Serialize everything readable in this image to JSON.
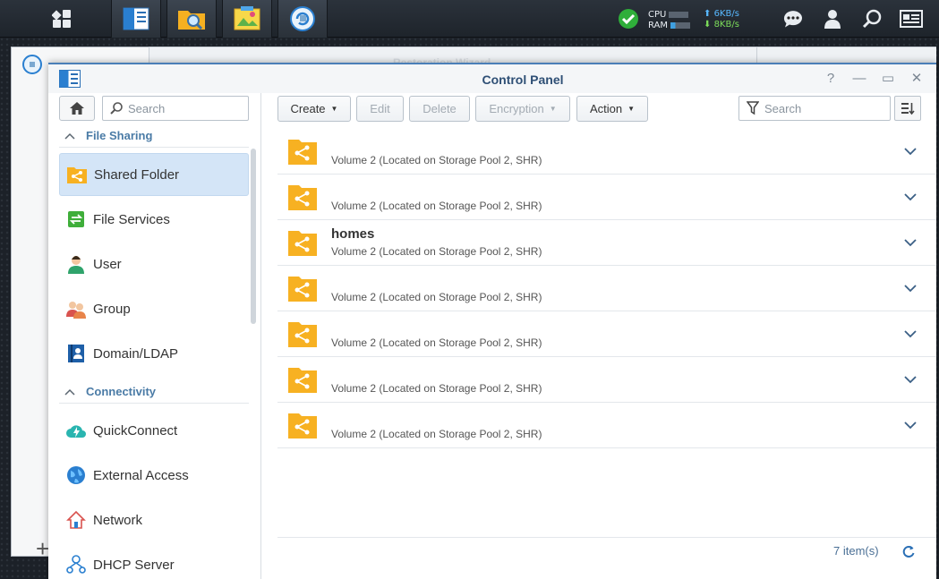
{
  "taskbar": {
    "perf": {
      "cpu_label": "CPU",
      "ram_label": "RAM",
      "upload": "6KB/s",
      "download": "8KB/s"
    }
  },
  "background_window": {
    "title": "Restoration Wizard"
  },
  "window": {
    "title": "Control Panel",
    "help": "?",
    "minimize": "—",
    "maximize": "▭",
    "close": "✕"
  },
  "sidebar": {
    "search_placeholder": "Search",
    "sections": [
      {
        "label": "File Sharing",
        "items": [
          {
            "label": "Shared Folder",
            "icon": "shared-folder-icon"
          },
          {
            "label": "File Services",
            "icon": "file-services-icon"
          },
          {
            "label": "User",
            "icon": "user-icon"
          },
          {
            "label": "Group",
            "icon": "group-icon"
          },
          {
            "label": "Domain/LDAP",
            "icon": "domain-ldap-icon"
          }
        ]
      },
      {
        "label": "Connectivity",
        "items": [
          {
            "label": "QuickConnect",
            "icon": "quickconnect-icon"
          },
          {
            "label": "External Access",
            "icon": "external-access-icon"
          },
          {
            "label": "Network",
            "icon": "network-icon"
          },
          {
            "label": "DHCP Server",
            "icon": "dhcp-server-icon"
          }
        ]
      }
    ]
  },
  "toolbar": {
    "create": "Create",
    "edit": "Edit",
    "delete": "Delete",
    "encryption": "Encryption",
    "action": "Action",
    "search_placeholder": "Search"
  },
  "folders": [
    {
      "name": "",
      "desc": "Volume 2 (Located on Storage Pool 2, SHR)"
    },
    {
      "name": "",
      "desc": "Volume 2 (Located on Storage Pool 2, SHR)"
    },
    {
      "name": "homes",
      "desc": "Volume 2 (Located on Storage Pool 2, SHR)"
    },
    {
      "name": "",
      "desc": "Volume 2 (Located on Storage Pool 2, SHR)"
    },
    {
      "name": "",
      "desc": "Volume 2 (Located on Storage Pool 2, SHR)"
    },
    {
      "name": "",
      "desc": "Volume 2 (Located on Storage Pool 2, SHR)"
    },
    {
      "name": "",
      "desc": "Volume 2 (Located on Storage Pool 2, SHR)"
    }
  ],
  "footer": {
    "count": "7 item(s)"
  },
  "colors": {
    "accent": "#4a7ba6",
    "folder": "#f7b122",
    "selected": "#d4e5f7"
  }
}
